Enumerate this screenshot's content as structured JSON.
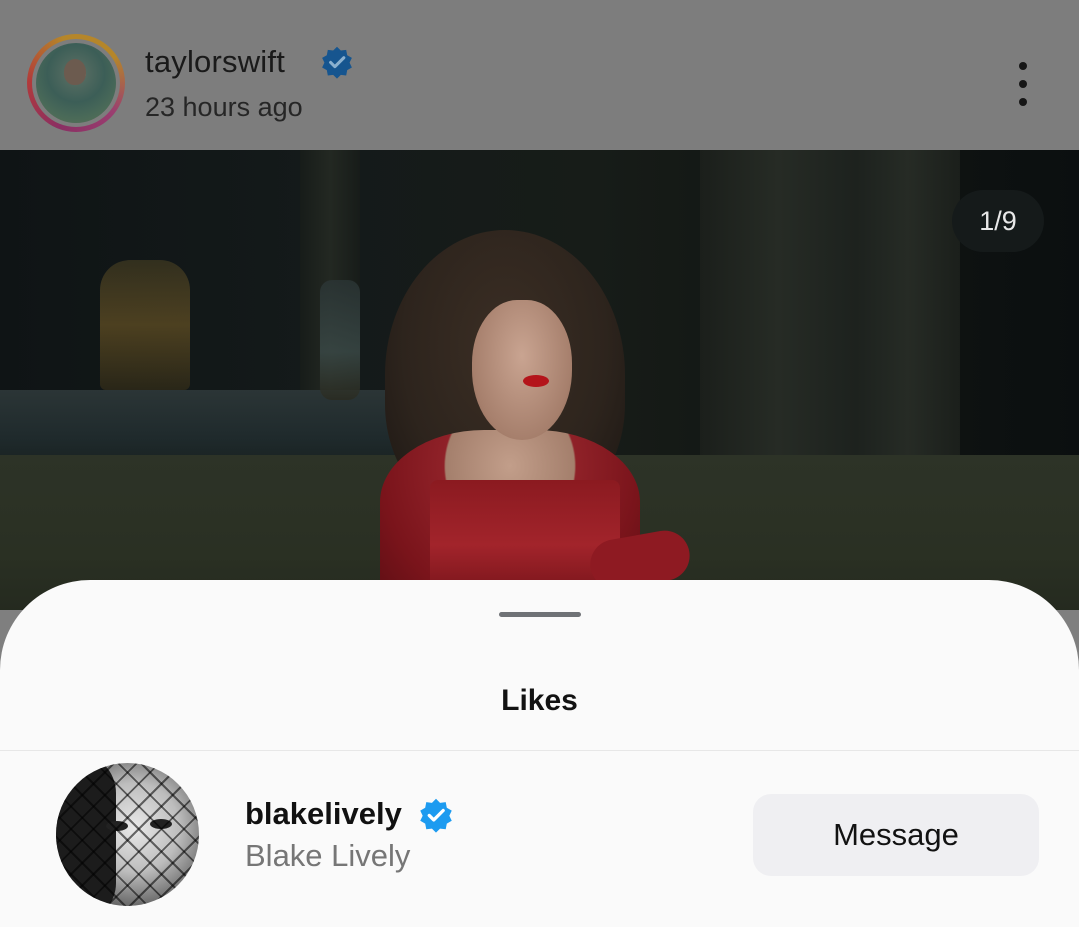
{
  "post": {
    "username": "taylorswift",
    "verified": true,
    "time_ago": "23 hours ago",
    "more_icon": "more-vertical-icon"
  },
  "photo": {
    "counter": "1/9"
  },
  "likes_sheet": {
    "title": "Likes",
    "items": [
      {
        "username": "blakelively",
        "full_name": "Blake Lively",
        "verified": true,
        "action_label": "Message"
      }
    ]
  },
  "colors": {
    "verified_badge": "#1d9bf0",
    "button_bg": "#efeff2",
    "secondary_text": "#767676"
  }
}
